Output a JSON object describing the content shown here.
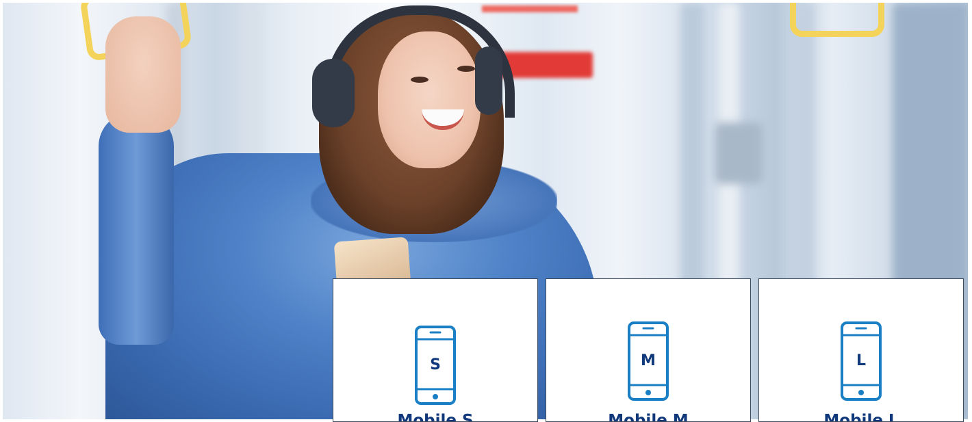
{
  "hero": {
    "image_icon": "woman-with-headphones-photo"
  },
  "plans": [
    {
      "size": "S",
      "name": "Mobile S",
      "icon": "smartphone-icon"
    },
    {
      "size": "M",
      "name": "Mobile M",
      "icon": "smartphone-icon"
    },
    {
      "size": "L",
      "name": "Mobile L",
      "icon": "smartphone-icon"
    }
  ],
  "colors": {
    "accent": "#1a7fc4",
    "text": "#10387a",
    "card_border": "#3c4a5c",
    "card_background": "#ffffff"
  }
}
